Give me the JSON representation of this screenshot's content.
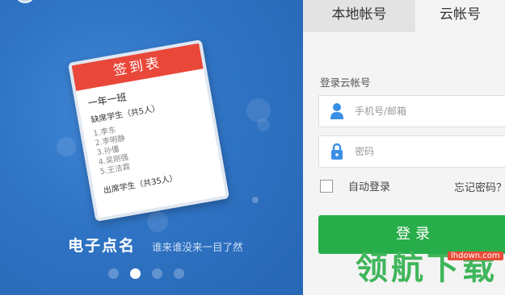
{
  "promo": {
    "card": {
      "header": "签到表",
      "class_name": "一年一班",
      "absent_title": "缺席学生（共5人）",
      "absent_students": [
        "1.李东",
        "2.李明静",
        "3.孙僵",
        "4.吴刚强",
        "5.王洁霖"
      ],
      "present_title": "出席学生（共35人）"
    },
    "title": "电子点名",
    "subtitle": "谁来谁没来一目了然",
    "carousel": {
      "total": 4,
      "active_index": 1
    }
  },
  "login": {
    "tabs": [
      {
        "label": "本地帐号",
        "active": false
      },
      {
        "label": "云帐号",
        "active": true
      }
    ],
    "section_label": "登录云帐号",
    "username": {
      "placeholder": "手机号/邮箱",
      "value": "",
      "icon": "user-icon"
    },
    "password": {
      "placeholder": "密码",
      "value": "",
      "icon": "lock-icon"
    },
    "remember_label": "自动登录",
    "remember_checked": false,
    "forgot_label": "忘记密码？",
    "submit_label": "登录"
  },
  "watermark": {
    "text": "领航下载",
    "url": "lhdown.com"
  },
  "colors": {
    "promo_blue": "#2f73c4",
    "icon_blue": "#3a8ee6",
    "card_header_red": "#e9473a",
    "login_green": "#27ae4a"
  }
}
